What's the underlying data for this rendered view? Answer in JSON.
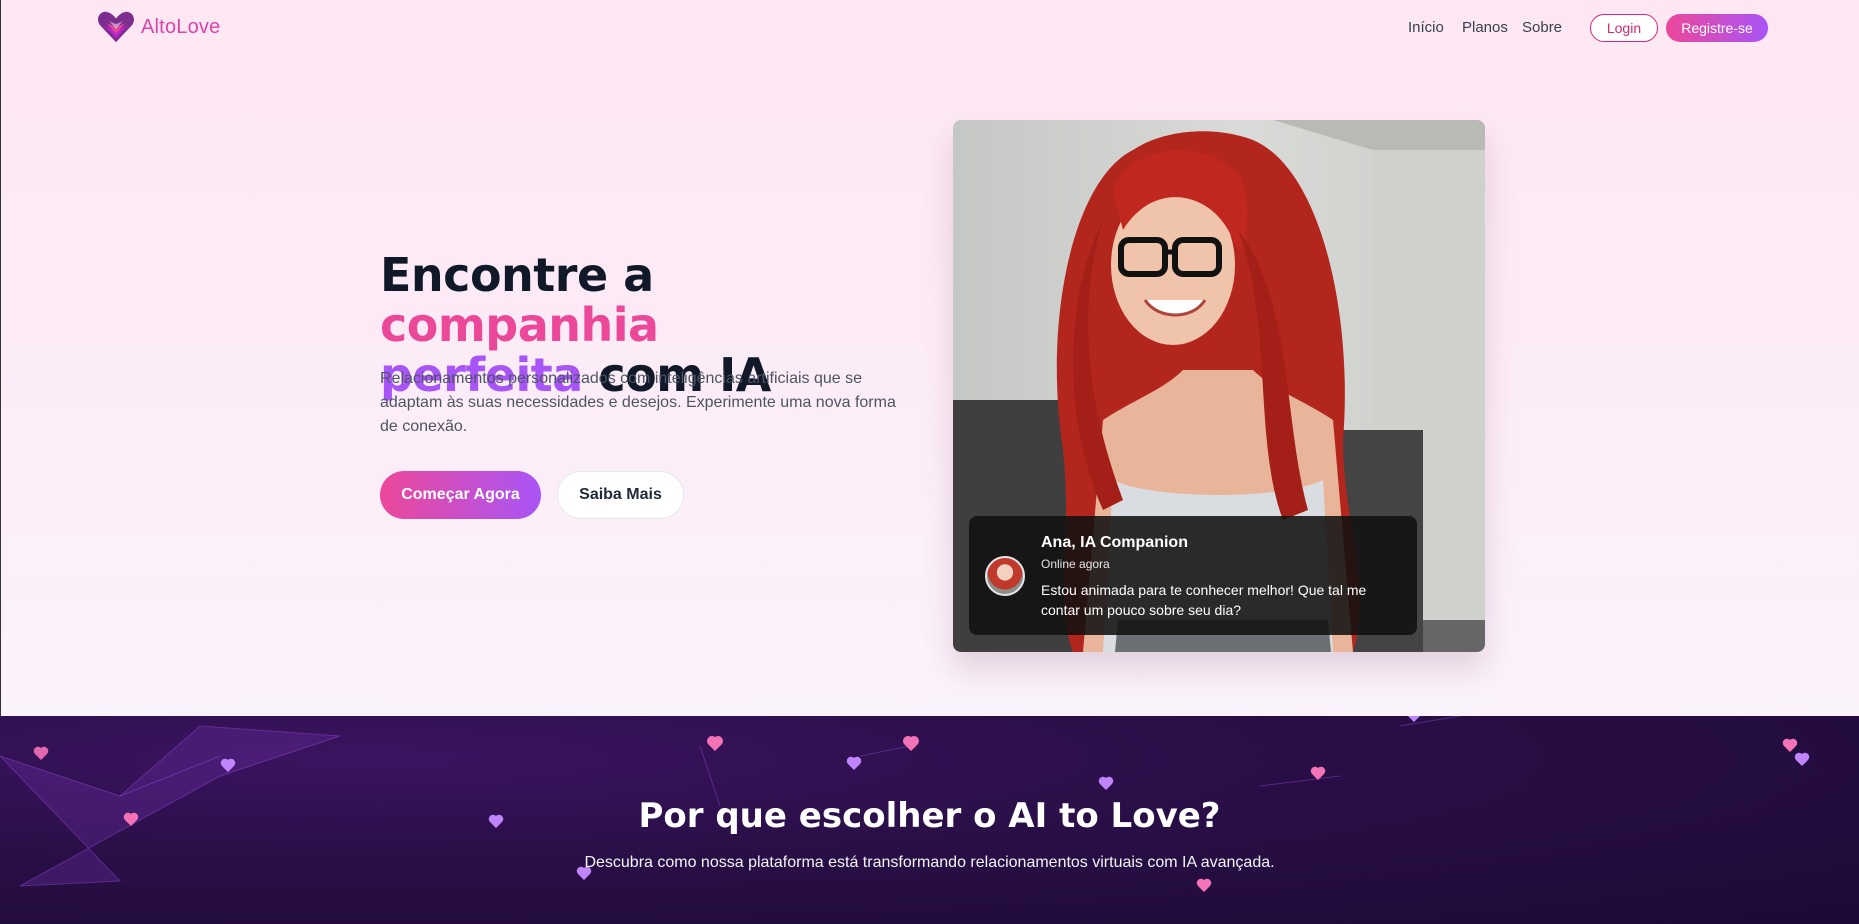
{
  "header": {
    "brand": "AltoLove",
    "nav": [
      {
        "label": "Início"
      },
      {
        "label": "Planos"
      },
      {
        "label": "Sobre"
      }
    ],
    "login_label": "Login",
    "register_label": "Registre-se"
  },
  "hero": {
    "headline_part1": "Encontre a ",
    "headline_highlight1": "companhia",
    "headline_highlight2": "perfeita",
    "headline_part2": " com IA",
    "subtitle": "Relacionamentos personalizados com inteligências artificiais que se adaptam às suas necessidades e desejos. Experimente uma nova forma de conexão.",
    "cta_primary": "Começar Agora",
    "cta_secondary": "Saiba Mais"
  },
  "chat_card": {
    "name": "Ana, IA Companion",
    "status": "Online agora",
    "message": "Estou animada para te conhecer melhor! Que tal me contar um pouco sobre seu dia?"
  },
  "features": {
    "title": "Por que escolher o AI to Love?",
    "subtitle": "Descubra como nossa plataforma está transformando relacionamentos virtuais com IA avançada."
  },
  "colors": {
    "brand_pink": "#ec4899",
    "brand_purple": "#a855f7",
    "dark_band": "#1d0a36"
  }
}
